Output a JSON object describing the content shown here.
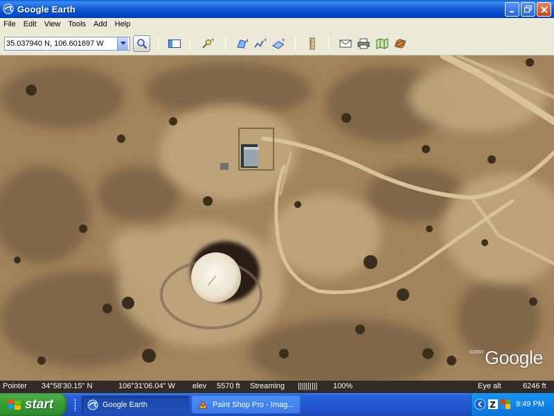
{
  "window": {
    "title": "Google Earth",
    "icon": "google-earth-globe-icon"
  },
  "menu": [
    "File",
    "Edit",
    "View",
    "Tools",
    "Add",
    "Help"
  ],
  "toolbar": {
    "coordinates_value": "35.037940 N, 106.601697 W",
    "search_icon": "magnifier-icon",
    "buttons": [
      "sidebar-toggle",
      "placemark",
      "polygon",
      "path",
      "image-overlay",
      "ruler",
      "email",
      "print",
      "view-in-maps",
      "sky-switch"
    ]
  },
  "map": {
    "copyright": "©2007",
    "watermark": "Google"
  },
  "status": {
    "pointer_label": "Pointer",
    "pointer_lat": "34°58'30.15\" N",
    "pointer_lon": "106°31'06.04\" W",
    "elev_label": "elev",
    "elev_value": "5570 ft",
    "streaming_label": "Streaming",
    "streaming_bar": "||||||||||",
    "streaming_pct": "100%",
    "eye_alt_label": "Eye alt",
    "eye_alt_value": "6246 ft"
  },
  "taskbar": {
    "start_label": "start",
    "tasks": [
      {
        "label": "Google Earth",
        "active": true,
        "icon": "google-earth-globe-icon"
      },
      {
        "label": "Paint Shop Pro - Imag...",
        "active": false,
        "icon": "paint-shop-pro-icon"
      }
    ],
    "clock": "9:49 PM"
  },
  "colors": {
    "titlebar": "#0a5fd8",
    "chrome": "#ece9d8",
    "taskbar": "#2457d0",
    "start": "#3c9d38",
    "terrain": "#a8875d",
    "road": "#d9c29a"
  }
}
